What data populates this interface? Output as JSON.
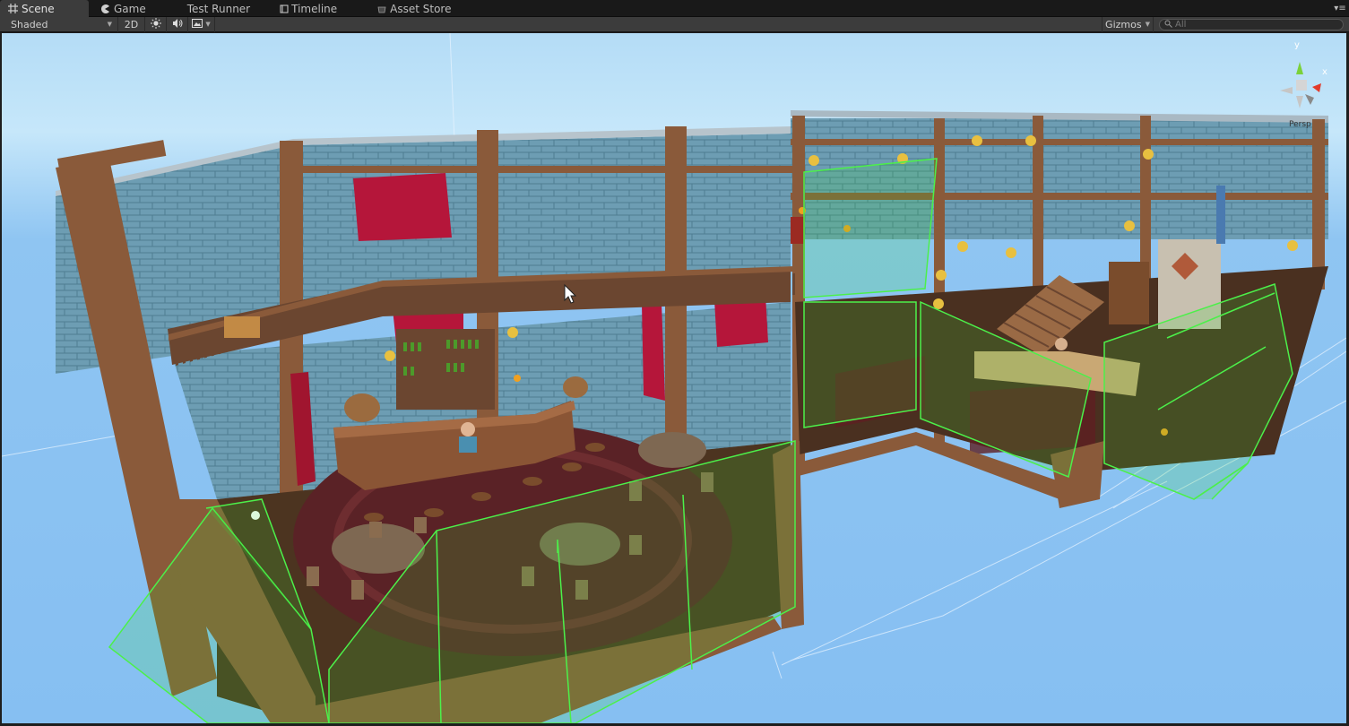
{
  "tabs": [
    {
      "label": "Scene",
      "icon": "scene-grid-icon",
      "active": true
    },
    {
      "label": "Game",
      "icon": "game-pacman-icon",
      "active": false
    },
    {
      "label": "Test Runner",
      "icon": "",
      "active": false
    },
    {
      "label": "Timeline",
      "icon": "timeline-icon",
      "active": false
    },
    {
      "label": "Asset Store",
      "icon": "",
      "active": false
    }
  ],
  "toolbar": {
    "draw_mode": "Shaded",
    "mode_2d": "2D",
    "gizmos": "Gizmos",
    "search_placeholder": "All"
  },
  "gizmo": {
    "axis_y": "y",
    "axis_x": "x",
    "projection": "Persp"
  },
  "colors": {
    "sky": "#86bff2",
    "wall_stone": "#6b9cb2",
    "wood": "#8a5a3a",
    "trigger_green": "#39e03a",
    "banner_red": "#b5163a",
    "carpet": "#5a2226"
  }
}
